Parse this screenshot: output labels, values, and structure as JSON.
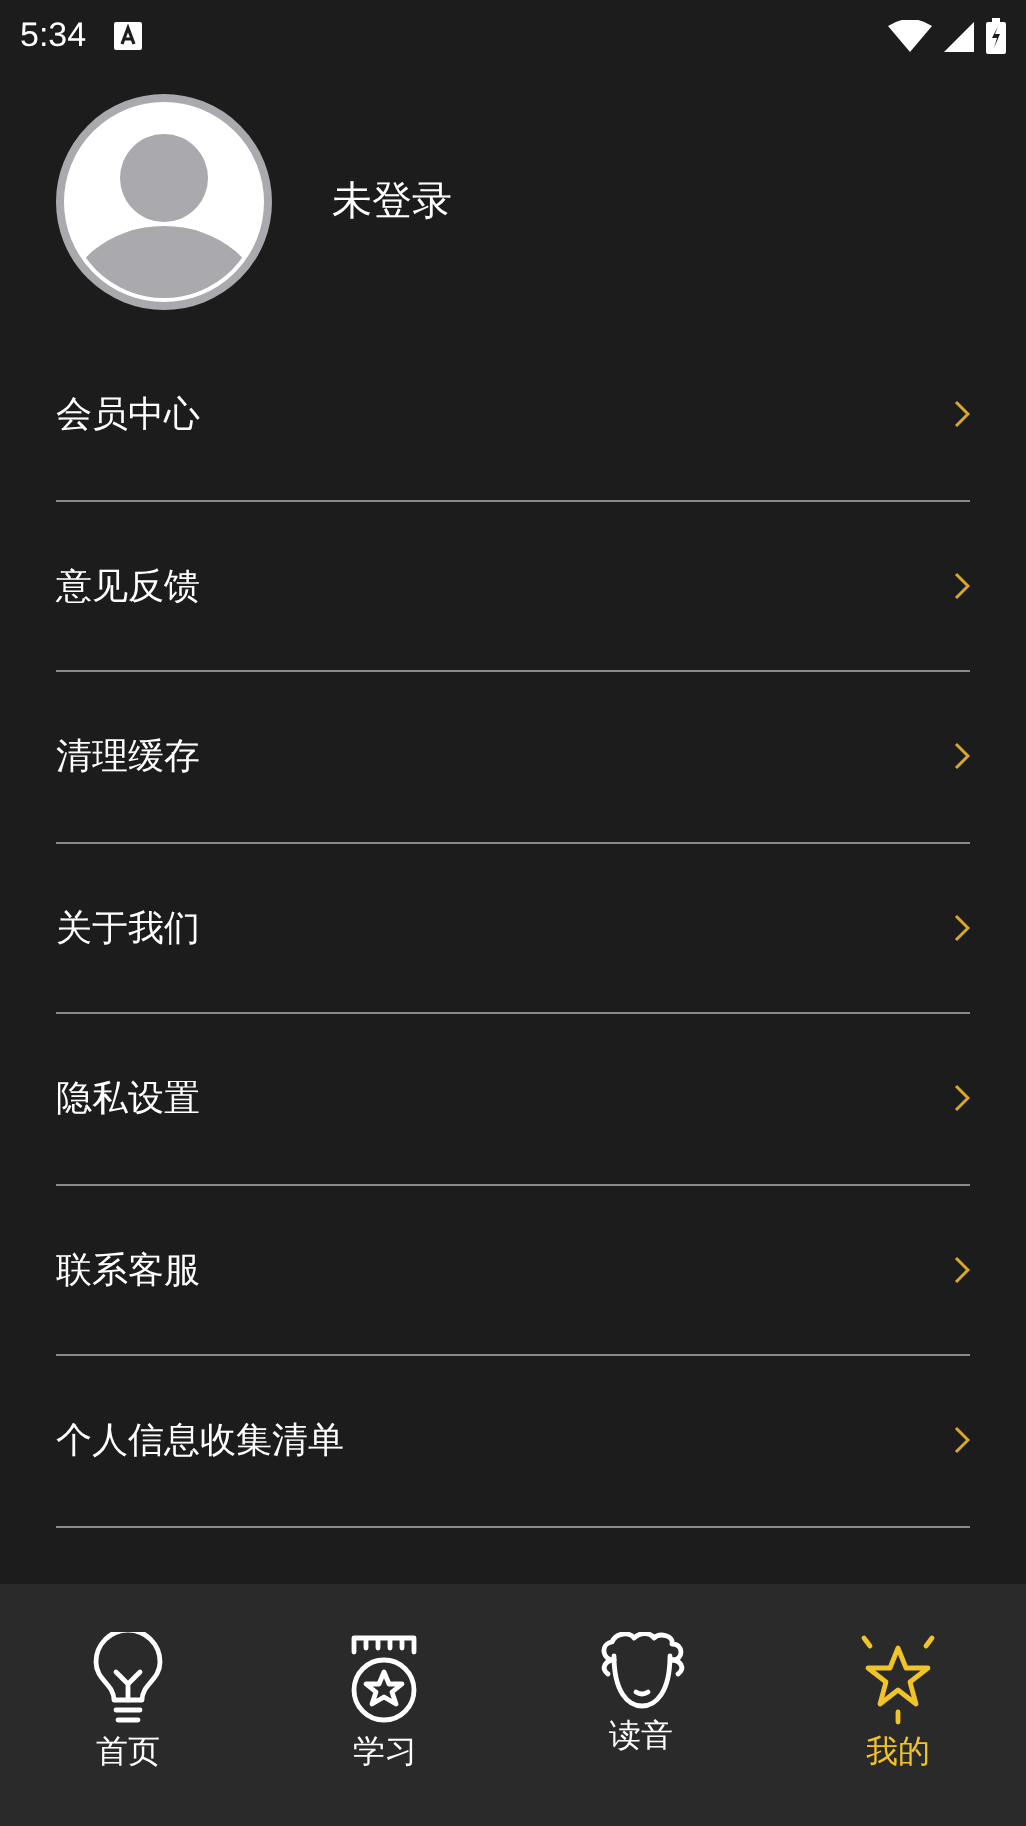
{
  "status_bar": {
    "time": "5:34"
  },
  "profile": {
    "name": "未登录"
  },
  "menu": [
    {
      "label": "会员中心"
    },
    {
      "label": "意见反馈"
    },
    {
      "label": "清理缓存"
    },
    {
      "label": "关于我们"
    },
    {
      "label": "隐私设置"
    },
    {
      "label": "联系客服"
    },
    {
      "label": "个人信息收集清单"
    }
  ],
  "tabs": [
    {
      "label": "首页",
      "kind": "bulb",
      "selected": false
    },
    {
      "label": "学习",
      "kind": "medal",
      "selected": false
    },
    {
      "label": "读音",
      "kind": "sheep",
      "selected": false
    },
    {
      "label": "我的",
      "kind": "star",
      "selected": true
    }
  ]
}
